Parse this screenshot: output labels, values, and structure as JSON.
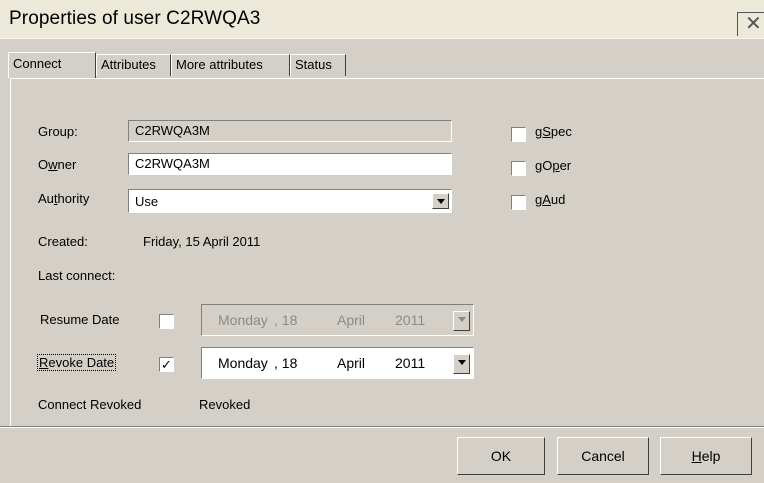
{
  "window": {
    "title": "Properties of user C2RWQA3",
    "close_icon": "close-icon"
  },
  "tabs": [
    {
      "label": "Connect",
      "active": true
    },
    {
      "label": "Attributes",
      "active": false
    },
    {
      "label": "More attributes",
      "active": false
    },
    {
      "label": "Status",
      "active": false
    }
  ],
  "connect": {
    "group_label": "Group:",
    "group_value": "C2RWQA3M",
    "owner_label_pre": "O",
    "owner_label_ul": "w",
    "owner_label_post": "ner",
    "owner_value": "C2RWQA3M",
    "authority_label_pre": "Au",
    "authority_label_ul": "t",
    "authority_label_post": "hority",
    "authority_value": "Use",
    "created_label": "Created:",
    "created_value": "Friday, 15 April 2011",
    "last_connect_label": "Last connect:",
    "resume_label": "Resume Date",
    "resume_checked": "",
    "resume_date": {
      "weekday": "Monday",
      "day": ", 18",
      "month": "April",
      "year": "2011"
    },
    "revoke_label_pre": "",
    "revoke_label_ul": "R",
    "revoke_label_post": "evoke Date",
    "revoke_checked": "✓",
    "revoke_date": {
      "weekday": "Monday",
      "day": ", 18",
      "month": "April",
      "year": "2011"
    },
    "connect_revoked_label": "Connect Revoked",
    "connect_revoked_value": "Revoked",
    "checks": [
      {
        "pre": "g",
        "ul": "S",
        "post": "pec",
        "checked": ""
      },
      {
        "pre": "gO",
        "ul": "p",
        "post": "er",
        "checked": ""
      },
      {
        "pre": "g",
        "ul": "A",
        "post": "ud",
        "checked": ""
      }
    ]
  },
  "buttons": {
    "ok": "OK",
    "cancel": "Cancel",
    "help_ul": "H",
    "help_post": "elp"
  }
}
